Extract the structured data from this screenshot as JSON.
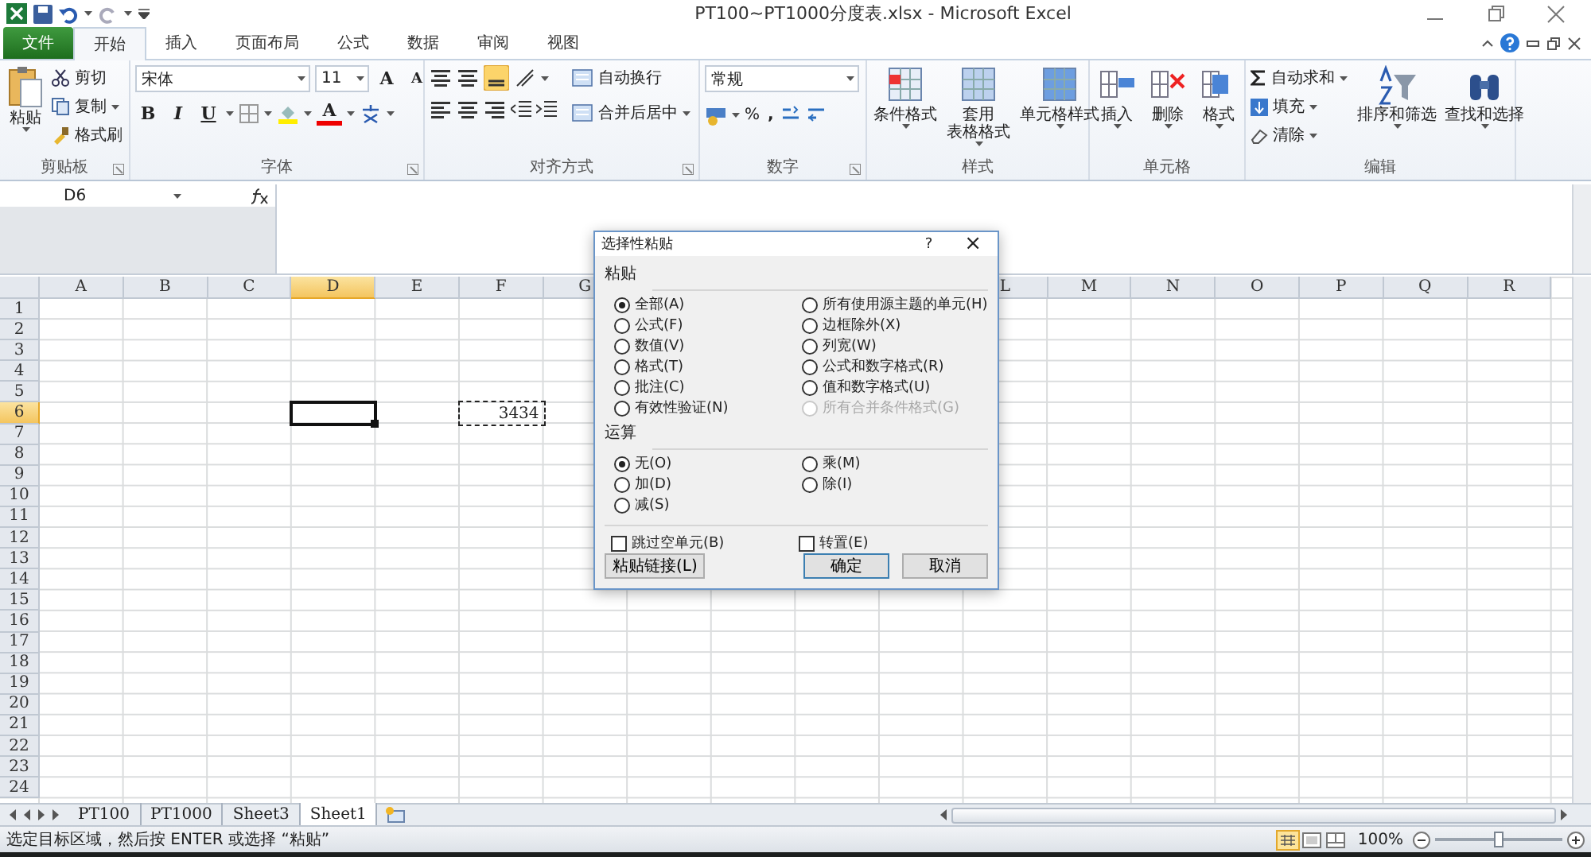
{
  "window": {
    "title": "PT100~PT1000分度表.xlsx - Microsoft Excel"
  },
  "ribbon_tabs": [
    {
      "label": "文件",
      "kind": "file",
      "selected": false
    },
    {
      "label": "开始",
      "kind": "tab",
      "selected": true
    },
    {
      "label": "插入",
      "kind": "tab",
      "selected": false
    },
    {
      "label": "页面布局",
      "kind": "tab",
      "selected": false
    },
    {
      "label": "公式",
      "kind": "tab",
      "selected": false
    },
    {
      "label": "数据",
      "kind": "tab",
      "selected": false
    },
    {
      "label": "审阅",
      "kind": "tab",
      "selected": false
    },
    {
      "label": "视图",
      "kind": "tab",
      "selected": false
    }
  ],
  "ribbon_groups": [
    {
      "label": "剪贴板",
      "buttons": [
        {
          "label": "粘贴"
        },
        {
          "label": "剪切"
        },
        {
          "label": "复制"
        },
        {
          "label": "格式刷"
        }
      ]
    },
    {
      "label": "字体",
      "font": "宋体",
      "size": "11",
      "grow": "A",
      "shrink": "A",
      "buttons": [
        {
          "label": "B"
        },
        {
          "label": "I"
        },
        {
          "label": "U"
        },
        {
          "label": "A"
        }
      ]
    },
    {
      "label": "对齐方式",
      "buttons": [
        {
          "label": "自动换行"
        },
        {
          "label": "合并后居中"
        }
      ]
    },
    {
      "label": "数字",
      "format": "常规",
      "buttons": [
        {
          "label": "%"
        },
        {
          "label": ","
        }
      ]
    },
    {
      "label": "样式",
      "buttons": [
        {
          "label": "条件格式"
        },
        {
          "lines": [
            "套用",
            "表格格式"
          ]
        },
        {
          "label": "单元格样式"
        }
      ]
    },
    {
      "label": "单元格",
      "buttons": [
        {
          "label": "插入"
        },
        {
          "label": "删除"
        },
        {
          "label": "格式"
        }
      ]
    },
    {
      "label": "编辑",
      "buttons": [
        {
          "label": "自动求和"
        },
        {
          "label": "填充"
        },
        {
          "label": "清除"
        },
        {
          "label": "排序和筛选"
        },
        {
          "label": "查找和选择"
        }
      ]
    }
  ],
  "name_box": "D6",
  "columns": [
    {
      "label": "A",
      "selected": false
    },
    {
      "label": "B",
      "selected": false
    },
    {
      "label": "C",
      "selected": false
    },
    {
      "label": "D",
      "selected": true
    },
    {
      "label": "E",
      "selected": false
    },
    {
      "label": "F",
      "selected": false
    },
    {
      "label": "G",
      "selected": false
    },
    {},
    {},
    {},
    {},
    {
      "label": "L",
      "selected": false
    },
    {
      "label": "M",
      "selected": false
    },
    {
      "label": "N",
      "selected": false
    },
    {
      "label": "O",
      "selected": false
    },
    {
      "label": "P",
      "selected": false
    },
    {
      "label": "Q",
      "selected": false
    },
    {
      "label": "R",
      "selected": false
    }
  ],
  "rows": [
    {
      "label": "1",
      "selected": false
    },
    {
      "label": "2",
      "selected": false
    },
    {
      "label": "3",
      "selected": false
    },
    {
      "label": "4",
      "selected": false
    },
    {
      "label": "5",
      "selected": false
    },
    {
      "label": "6",
      "selected": true,
      "cells": [
        {
          "kind": "empty"
        },
        {
          "kind": "empty"
        },
        {
          "kind": "empty"
        },
        {
          "kind": "active"
        },
        {
          "kind": "empty"
        },
        {
          "kind": "copied",
          "value": "3434"
        }
      ]
    },
    {
      "label": "7",
      "selected": false
    },
    {
      "label": "8",
      "selected": false
    },
    {
      "label": "9",
      "selected": false
    },
    {
      "label": "10",
      "selected": false
    },
    {
      "label": "11",
      "selected": false
    },
    {
      "label": "12",
      "selected": false
    },
    {
      "label": "13",
      "selected": false
    },
    {
      "label": "14",
      "selected": false
    },
    {
      "label": "15",
      "selected": false
    },
    {
      "label": "16",
      "selected": false
    },
    {
      "label": "17",
      "selected": false
    },
    {
      "label": "18",
      "selected": false
    },
    {
      "label": "19",
      "selected": false
    },
    {
      "label": "20",
      "selected": false
    },
    {
      "label": "21",
      "selected": false
    },
    {
      "label": "22",
      "selected": false
    },
    {
      "label": "23",
      "selected": false
    },
    {
      "label": "24",
      "selected": false
    }
  ],
  "sheet_tabs": [
    {
      "label": "PT100",
      "selected": false
    },
    {
      "label": "PT1000",
      "selected": false
    },
    {
      "label": "Sheet3",
      "selected": false
    },
    {
      "label": "Sheet1",
      "selected": true
    }
  ],
  "status_bar": {
    "message": "选定目标区域，然后按 ENTER 或选择 “粘贴”",
    "zoom": "100%",
    "zoom_slider": {
      "level": 0.5
    }
  },
  "dialog": {
    "title": "选择性粘贴",
    "help": "?",
    "close": "×",
    "sections": [
      {
        "label": "粘贴",
        "options": [
          {
            "label": "全部(A)",
            "selected": true,
            "disabled": false
          },
          {
            "label": "公式(F)",
            "selected": false,
            "disabled": false
          },
          {
            "label": "数值(V)",
            "selected": false,
            "disabled": false
          },
          {
            "label": "格式(T)",
            "selected": false,
            "disabled": false
          },
          {
            "label": "批注(C)",
            "selected": false,
            "disabled": false
          },
          {
            "label": "有效性验证(N)",
            "selected": false,
            "disabled": false
          },
          {
            "label": "所有使用源主题的单元(H)",
            "selected": false,
            "disabled": false
          },
          {
            "label": "边框除外(X)",
            "selected": false,
            "disabled": false
          },
          {
            "label": "列宽(W)",
            "selected": false,
            "disabled": false
          },
          {
            "label": "公式和数字格式(R)",
            "selected": false,
            "disabled": false
          },
          {
            "label": "值和数字格式(U)",
            "selected": false,
            "disabled": false
          },
          {
            "label": "所有合并条件格式(G)",
            "selected": false,
            "disabled": true
          }
        ]
      },
      {
        "label": "运算",
        "options": [
          {
            "label": "无(O)",
            "selected": true,
            "disabled": false
          },
          {
            "label": "加(D)",
            "selected": false,
            "disabled": false
          },
          {
            "label": "减(S)",
            "selected": false,
            "disabled": false
          },
          {
            "label": "乘(M)",
            "selected": false,
            "disabled": false
          },
          {
            "label": "除(I)",
            "selected": false,
            "disabled": false
          }
        ]
      }
    ],
    "checkboxes": [
      {
        "label": "跳过空单元(B)",
        "checked": false
      },
      {
        "label": "转置(E)",
        "checked": false
      }
    ],
    "buttons": [
      {
        "label": "粘贴链接(L)",
        "kind": "normal"
      },
      {
        "label": "确定",
        "kind": "default"
      },
      {
        "label": "取消",
        "kind": "normal"
      }
    ]
  }
}
